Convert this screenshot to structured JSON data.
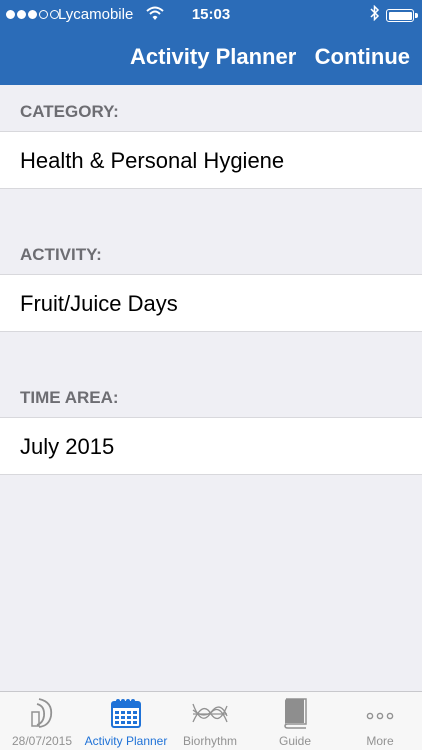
{
  "status_bar": {
    "carrier": "Lycamobile",
    "time": "15:03"
  },
  "nav": {
    "title": "Activity Planner",
    "continue_label": "Continue"
  },
  "sections": [
    {
      "label": "CATEGORY:",
      "value": "Health & Personal Hygiene"
    },
    {
      "label": "ACTIVITY:",
      "value": "Fruit/Juice Days"
    },
    {
      "label": "TIME AREA:",
      "value": "July 2015"
    }
  ],
  "tabs": [
    {
      "label": "28/07/2015",
      "icon": "moon-phase-icon"
    },
    {
      "label": "Activity Planner",
      "icon": "calendar-icon"
    },
    {
      "label": "Biorhythm",
      "icon": "biorhythm-chart-icon"
    },
    {
      "label": "Guide",
      "icon": "book-icon"
    },
    {
      "label": "More",
      "icon": "more-dots-icon"
    }
  ],
  "active_tab": "Activity Planner",
  "colors": {
    "nav_bar": "#2b6cb8",
    "active_tab": "#1f72d7",
    "inactive_tab": "#929292",
    "background": "#efeff4"
  }
}
